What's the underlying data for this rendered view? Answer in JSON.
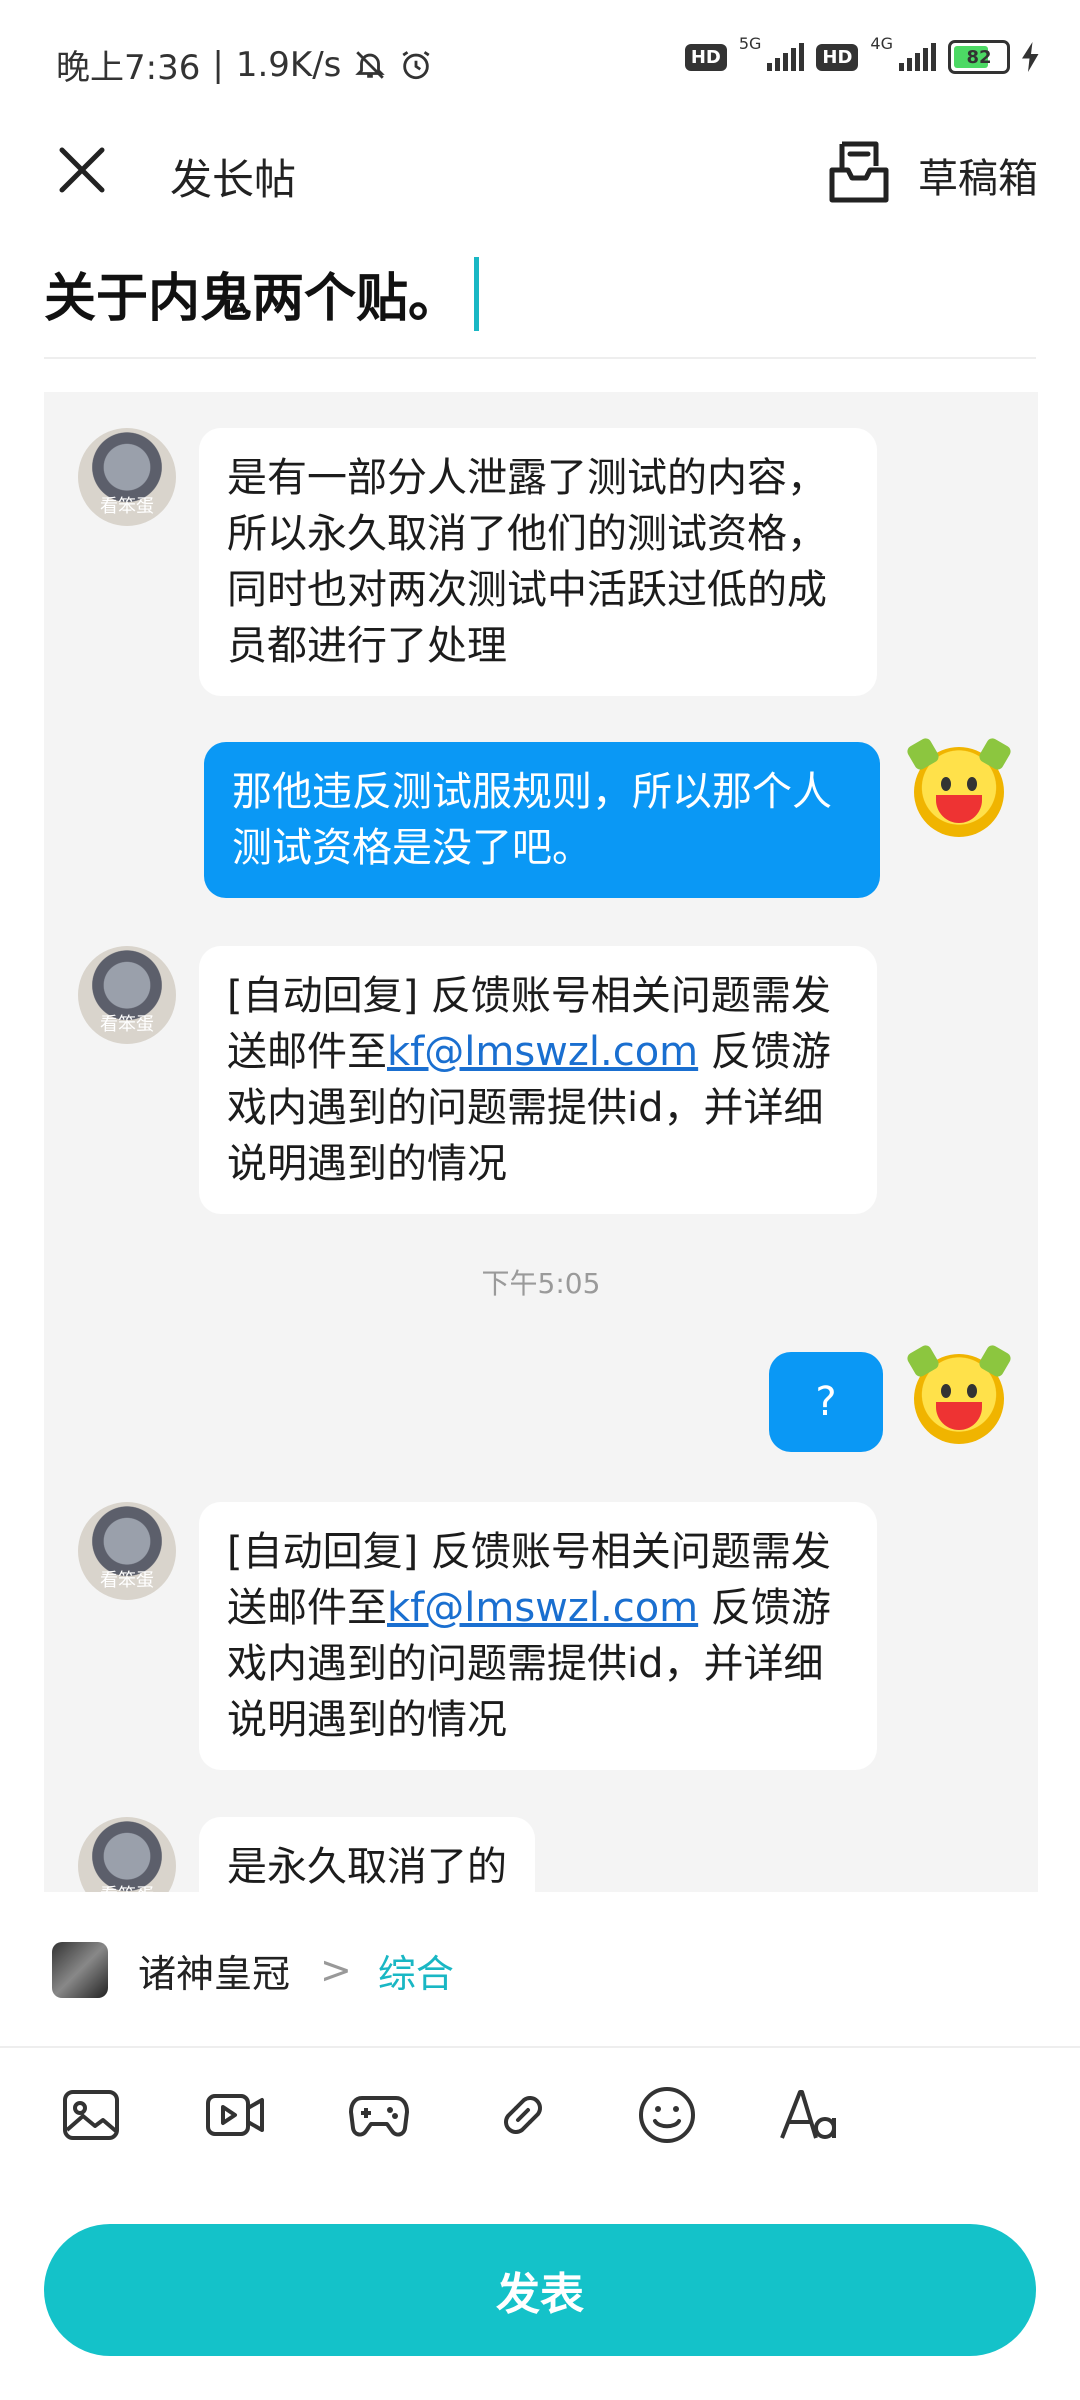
{
  "status_bar": {
    "time": "晚上7:36",
    "speed": "1.9K/s",
    "hd1": "HD",
    "net1": "5G",
    "hd2": "HD",
    "net2": "4G",
    "battery": "82"
  },
  "header": {
    "title": "发长帖",
    "drafts_label": "草稿箱"
  },
  "post": {
    "title": "关于内鬼两个贴。"
  },
  "chat": {
    "avatar_text": "看笨蛋",
    "messages": [
      {
        "side": "left",
        "text": "是有一部分人泄露了测试的内容，所以永久取消了他们的测试资格，同时也对两次测试中活跃过低的成员都进行了处理"
      },
      {
        "side": "right",
        "text": "那他违反测试服规则，所以那个人测试资格是没了吧。"
      },
      {
        "side": "left",
        "text_before": "[自动回复] 反馈账号相关问题需发送邮件至",
        "link": "kf@lmswzl.com",
        "text_after": " 反馈游戏内遇到的问题需提供id，并详细说明遇到的情况"
      },
      {
        "side": "time",
        "text": "下午5:05"
      },
      {
        "side": "right",
        "text": "?"
      },
      {
        "side": "left",
        "text_before": "[自动回复] 反馈账号相关问题需发送邮件至",
        "link": "kf@lmswzl.com",
        "text_after": " 反馈游戏内遇到的问题需提供id，并详细说明遇到的情况"
      },
      {
        "side": "left",
        "text": "是永久取消了的"
      }
    ]
  },
  "forum": {
    "name": "诸神皇冠",
    "chevron": ">",
    "category": "综合"
  },
  "toolbar": {
    "icons": [
      "image-icon",
      "video-icon",
      "game-icon",
      "link-icon",
      "emoji-icon",
      "text-format-icon"
    ]
  },
  "publish_label": "发表",
  "colors": {
    "accent": "#14c2c9",
    "bubble_blue": "#0a98f5",
    "link": "#1a6fd0"
  }
}
